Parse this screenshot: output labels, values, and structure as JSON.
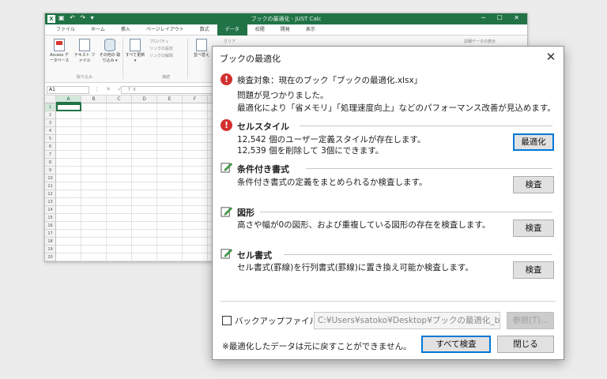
{
  "spreadsheet": {
    "title": "ブックの最適化 - JUST Calc",
    "qat": "▣ ↶ ↷ ▾",
    "window_controls": "─ ☐ ✕",
    "tabs": [
      "ファイル",
      "ホーム",
      "挿入",
      "ページレイアウト",
      "数式",
      "データ",
      "校閲",
      "開発",
      "表示"
    ],
    "active_tab": "データ",
    "ribbon": {
      "access": "Access データベース",
      "text_file": "テキスト ファイル",
      "other": "その他の 取り込み ▾",
      "group_import": "取り込み",
      "refresh_all": "すべて更新 ▾",
      "properties": "プロパティ",
      "link_settings": "リンクの設定",
      "link_remove": "リンクの解除",
      "group_connect": "接続",
      "sort": "並べ替え",
      "group": "グリア",
      "detail": "詳細データの表示"
    },
    "name_box": "A1",
    "fx_icons": "⋮ ✕ ✓ fx",
    "columns": [
      "A",
      "B",
      "C",
      "D",
      "E",
      "F"
    ],
    "rows": [
      "1",
      "2",
      "3",
      "4",
      "5",
      "6",
      "7",
      "8",
      "9",
      "10",
      "11",
      "12",
      "13",
      "14",
      "15",
      "16",
      "17",
      "18",
      "19",
      "20"
    ]
  },
  "dialog": {
    "title": "ブックの最適化",
    "summary": {
      "target": "検査対象：現在のブック「ブックの最適化.xlsx」",
      "found": "問題が見つかりました。",
      "improvement": "最適化により「省メモリ」「処理速度向上」などのパフォーマンス改善が見込めます。"
    },
    "sections": {
      "cell_style": {
        "title": "セルスタイル",
        "line1": "12,542 個のユーザー定義スタイルが存在します。",
        "line2": "12,539 個を削除して 3個にできます。",
        "button": "最適化"
      },
      "conditional": {
        "title": "条件付き書式",
        "desc": "条件付き書式の定義をまとめられるか検査します。",
        "button": "検査"
      },
      "shapes": {
        "title": "図形",
        "desc": "高さや幅が0の図形、および重複している図形の存在を検査します。",
        "button": "検査"
      },
      "cell_format": {
        "title": "セル書式",
        "desc": "セル書式(罫線)を行列書式(罫線)に置き換え可能か検査します。",
        "button": "検査"
      }
    },
    "backup": {
      "label": "バックアップファイル(U)",
      "path": "C:¥Users¥satoko¥Desktop¥ブックの最適化_backu",
      "browse": "参照(T)..."
    },
    "note": "※最適化したデータは元に戻すことができません。",
    "inspect_all": "すべて検査",
    "close": "閉じる"
  }
}
